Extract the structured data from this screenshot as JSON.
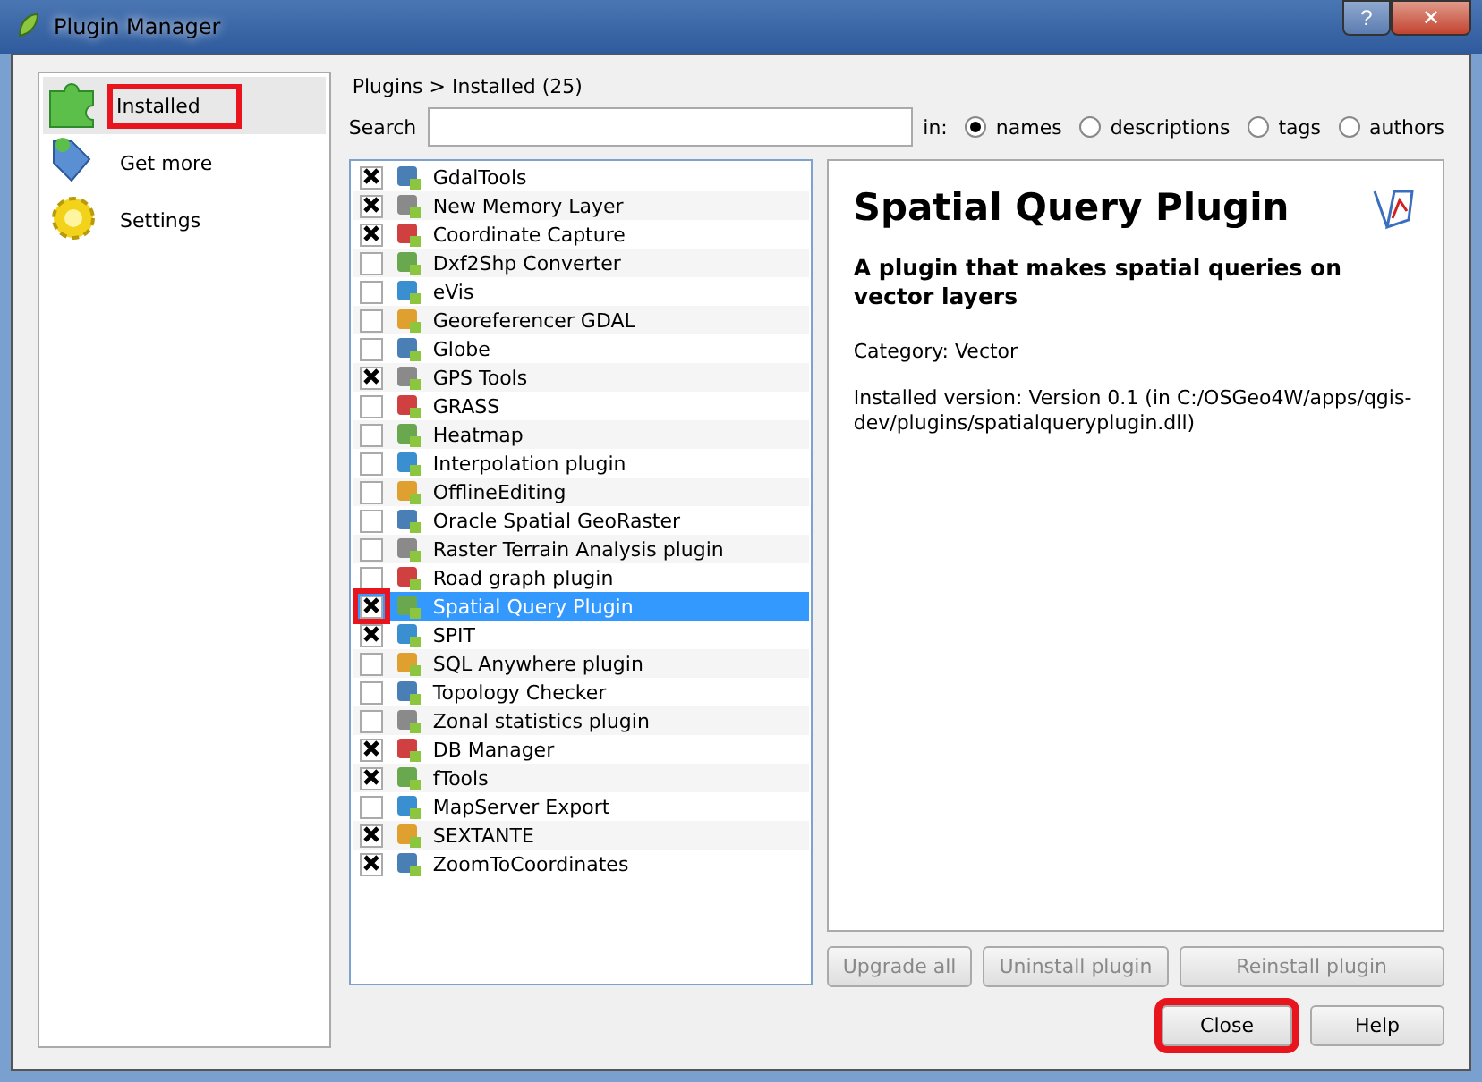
{
  "window": {
    "title": "Plugin Manager",
    "buttons": [
      "?",
      "✕"
    ]
  },
  "sidebar": {
    "items": [
      {
        "label": "Installed",
        "selected": true,
        "highlighted": true
      },
      {
        "label": "Get more",
        "selected": false,
        "highlighted": false
      },
      {
        "label": "Settings",
        "selected": false,
        "highlighted": false
      }
    ]
  },
  "breadcrumb": "Plugins > Installed (25)",
  "search": {
    "label": "Search",
    "in_label": "in:",
    "options": [
      {
        "label": "names",
        "selected": true
      },
      {
        "label": "descriptions",
        "selected": false
      },
      {
        "label": "tags",
        "selected": false
      },
      {
        "label": "authors",
        "selected": false
      }
    ]
  },
  "plugins": [
    {
      "name": "GdalTools",
      "checked": true,
      "selected": false,
      "highlighted": false
    },
    {
      "name": "New Memory Layer",
      "checked": true,
      "selected": false,
      "highlighted": false
    },
    {
      "name": "Coordinate Capture",
      "checked": true,
      "selected": false,
      "highlighted": false
    },
    {
      "name": "Dxf2Shp Converter",
      "checked": false,
      "selected": false,
      "highlighted": false
    },
    {
      "name": "eVis",
      "checked": false,
      "selected": false,
      "highlighted": false
    },
    {
      "name": "Georeferencer GDAL",
      "checked": false,
      "selected": false,
      "highlighted": false
    },
    {
      "name": "Globe",
      "checked": false,
      "selected": false,
      "highlighted": false
    },
    {
      "name": "GPS Tools",
      "checked": true,
      "selected": false,
      "highlighted": false
    },
    {
      "name": "GRASS",
      "checked": false,
      "selected": false,
      "highlighted": false
    },
    {
      "name": "Heatmap",
      "checked": false,
      "selected": false,
      "highlighted": false
    },
    {
      "name": "Interpolation plugin",
      "checked": false,
      "selected": false,
      "highlighted": false
    },
    {
      "name": "OfflineEditing",
      "checked": false,
      "selected": false,
      "highlighted": false
    },
    {
      "name": "Oracle Spatial GeoRaster",
      "checked": false,
      "selected": false,
      "highlighted": false
    },
    {
      "name": "Raster Terrain Analysis plugin",
      "checked": false,
      "selected": false,
      "highlighted": false
    },
    {
      "name": "Road graph plugin",
      "checked": false,
      "selected": false,
      "highlighted": false
    },
    {
      "name": "Spatial Query Plugin",
      "checked": true,
      "selected": true,
      "highlighted": true
    },
    {
      "name": "SPIT",
      "checked": true,
      "selected": false,
      "highlighted": false
    },
    {
      "name": "SQL Anywhere plugin",
      "checked": false,
      "selected": false,
      "highlighted": false
    },
    {
      "name": "Topology Checker",
      "checked": false,
      "selected": false,
      "highlighted": false
    },
    {
      "name": "Zonal statistics plugin",
      "checked": false,
      "selected": false,
      "highlighted": false
    },
    {
      "name": "DB Manager",
      "checked": true,
      "selected": false,
      "highlighted": false
    },
    {
      "name": "fTools",
      "checked": true,
      "selected": false,
      "highlighted": false
    },
    {
      "name": "MapServer Export",
      "checked": false,
      "selected": false,
      "highlighted": false
    },
    {
      "name": "SEXTANTE",
      "checked": true,
      "selected": false,
      "highlighted": false
    },
    {
      "name": "ZoomToCoordinates",
      "checked": true,
      "selected": false,
      "highlighted": false
    }
  ],
  "details": {
    "title": "Spatial Query Plugin",
    "description": "A plugin that makes spatial queries on vector layers",
    "category": "Category: Vector",
    "installed": "Installed version: Version 0.1 (in C:/OSGeo4W/apps/qgis-dev/plugins/spatialqueryplugin.dll)"
  },
  "actions": [
    {
      "label": "Upgrade all",
      "disabled": true
    },
    {
      "label": "Uninstall plugin",
      "disabled": true
    },
    {
      "label": "Reinstall plugin",
      "disabled": true
    }
  ],
  "buttons": [
    {
      "label": "Close",
      "highlighted": true
    },
    {
      "label": "Help",
      "highlighted": false
    }
  ]
}
